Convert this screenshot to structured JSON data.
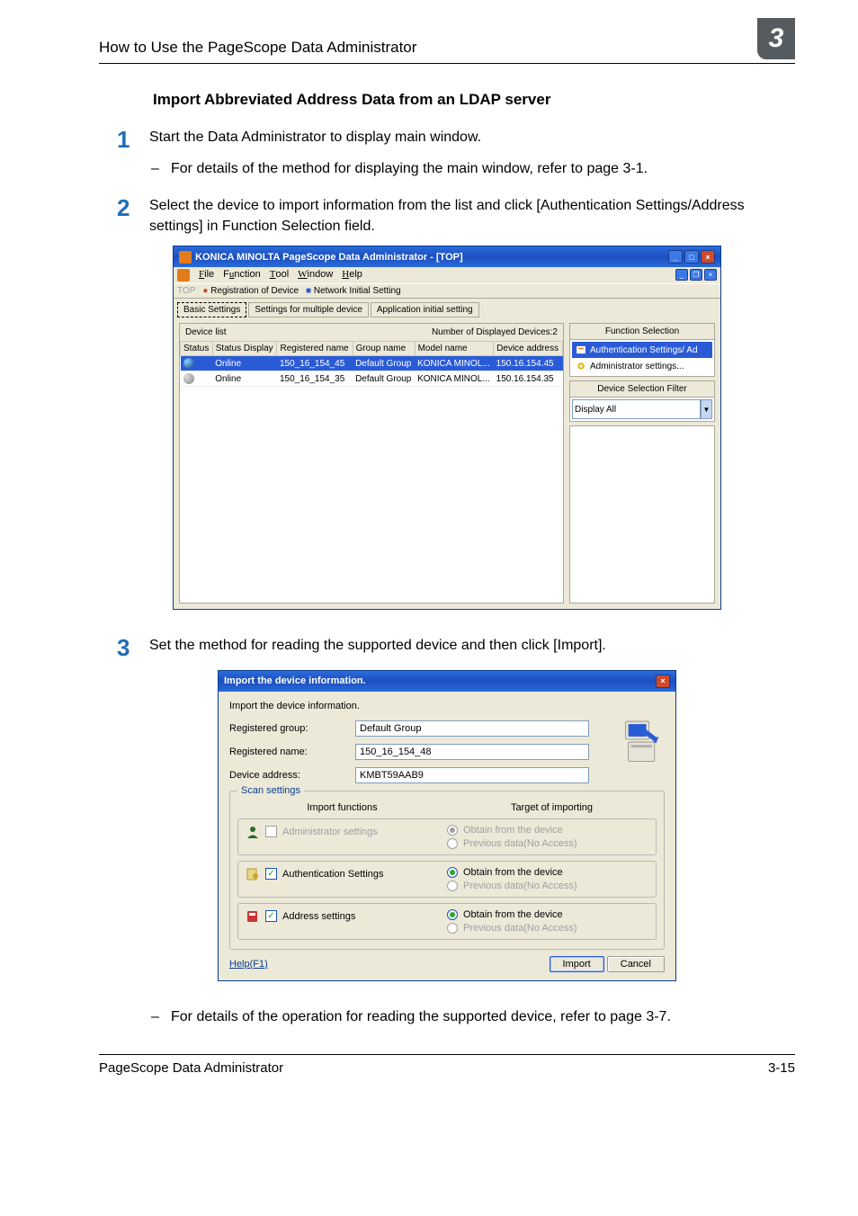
{
  "header": {
    "running_title": "How to Use the PageScope Data Administrator",
    "chapter_number": "3"
  },
  "section": {
    "title": "Import Abbreviated Address Data from an LDAP server"
  },
  "steps": {
    "s1": {
      "num": "1",
      "text": "Start the Data Administrator to display main window.",
      "sub": "For details of the method for displaying the main window, refer to page 3-1."
    },
    "s2": {
      "num": "2",
      "text": "Select the device to import information from the list and click [Authentication Settings/Address settings] in Function Selection field."
    },
    "s3": {
      "num": "3",
      "text": "Set the method for reading the supported device and then click [Import].",
      "sub": "For details of the operation for reading the supported device, refer to page 3-7."
    }
  },
  "screenshot1": {
    "title": "KONICA MINOLTA PageScope Data Administrator - [TOP]",
    "menu": {
      "file": "File",
      "function": "Function",
      "tool": "Tool",
      "window": "Window",
      "help": "Help"
    },
    "toolbar": {
      "top": "TOP",
      "reg": "Registration of Device",
      "net": "Network Initial Setting"
    },
    "tabs": {
      "basic": "Basic Settings",
      "multi": "Settings for multiple device",
      "app": "Application initial setting"
    },
    "devlist": {
      "label": "Device list",
      "count_label": "Number of Displayed Devices:2",
      "cols": {
        "status": "Status",
        "disp": "Status Display",
        "reg": "Registered name",
        "group": "Group name",
        "model": "Model name",
        "addr": "Device address"
      },
      "rows": [
        {
          "status": "",
          "disp": "Online",
          "reg": "150_16_154_45",
          "group": "Default Group",
          "model": "KONICA MINOL...",
          "addr": "150.16.154.45",
          "sel": true
        },
        {
          "status": "",
          "disp": "Online",
          "reg": "150_16_154_35",
          "group": "Default Group",
          "model": "KONICA MINOL...",
          "addr": "150.16.154.35",
          "sel": false
        }
      ]
    },
    "right": {
      "fs_title": "Function Selection",
      "auth": "Authentication Settings/ Ad",
      "admin": "Administrator settings...",
      "filter_title": "Device Selection Filter",
      "filter_value": "Display All"
    }
  },
  "screenshot2": {
    "title": "Import the device information.",
    "head": "Import the device information.",
    "rows": {
      "group_l": "Registered group:",
      "group_v": "Default Group",
      "name_l": "Registered name:",
      "name_v": "150_16_154_48",
      "addr_l": "Device address:",
      "addr_v": "KMBT59AAB9"
    },
    "fieldset": {
      "legend": "Scan settings",
      "col1": "Import functions",
      "col2": "Target of importing",
      "r1": {
        "label": "Administrator settings",
        "opt1": "Obtain from the device",
        "opt2": "Previous data(No Access)"
      },
      "r2": {
        "label": "Authentication Settings",
        "opt1": "Obtain from the device",
        "opt2": "Previous data(No Access)"
      },
      "r3": {
        "label": "Address settings",
        "opt1": "Obtain from the device",
        "opt2": "Previous data(No Access)"
      }
    },
    "help": "Help(F1)",
    "import_btn": "Import",
    "cancel_btn": "Cancel"
  },
  "footer": {
    "left": "PageScope Data Administrator",
    "right": "3-15"
  }
}
